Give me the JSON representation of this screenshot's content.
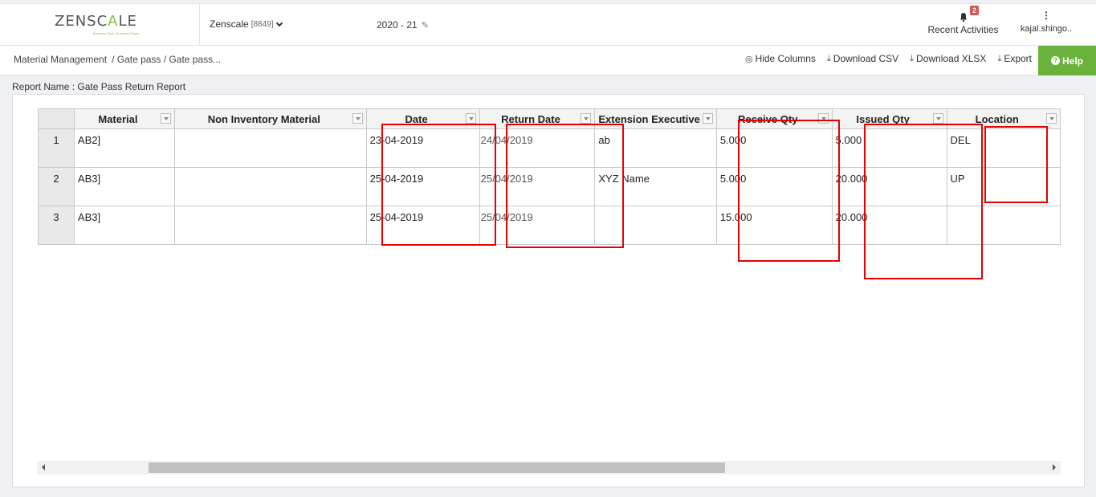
{
  "header": {
    "logo_left": "ZENSC",
    "logo_mid": "A",
    "logo_right": "LE",
    "logo_tagline": "Business Ease. Business Peace.",
    "company_name": "Zenscale",
    "company_code": "[8849]",
    "fiscal_year": "2020 - 21",
    "notifications_count": "2",
    "recent_label": "Recent Activities",
    "user_label": "kajal.shingo.."
  },
  "breadcrumb": {
    "root": "Material Management",
    "trail": "/ Gate pass / Gate pass..."
  },
  "toolbar": {
    "hide_columns": "Hide Columns",
    "download_csv": "Download CSV",
    "download_xlsx": "Download XLSX",
    "export": "Export",
    "help": "Help"
  },
  "report": {
    "name": "Report Name : Gate Pass Return Report"
  },
  "table": {
    "columns": [
      "Material",
      "Non Inventory Material",
      "Date",
      "Return Date",
      "Extension Executive",
      "Receive Qty",
      "Issued Qty",
      "Location"
    ],
    "rows": [
      {
        "num": "1",
        "material": "AB2]",
        "non_inventory": "",
        "date": "23-04-2019",
        "return_date": "24/04/2019",
        "executive": "ab",
        "receive_qty": "5.000",
        "issued_qty": "5.000",
        "location": "DEL"
      },
      {
        "num": "2",
        "material": "AB3]",
        "non_inventory": "",
        "date": "25-04-2019",
        "return_date": "25/04/2019",
        "executive": "XYZ Name",
        "receive_qty": "5.000",
        "issued_qty": "20.000",
        "location": "UP"
      },
      {
        "num": "3",
        "material": "AB3]",
        "non_inventory": "",
        "date": "25-04-2019",
        "return_date": "25/04/2019",
        "executive": "",
        "receive_qty": "15.000",
        "issued_qty": "20.000",
        "location": ""
      }
    ]
  },
  "colors": {
    "brand_green": "#7cc243",
    "help_green": "#6ab23c",
    "badge_red": "#d9534f",
    "annotation_red": "#e60000"
  }
}
